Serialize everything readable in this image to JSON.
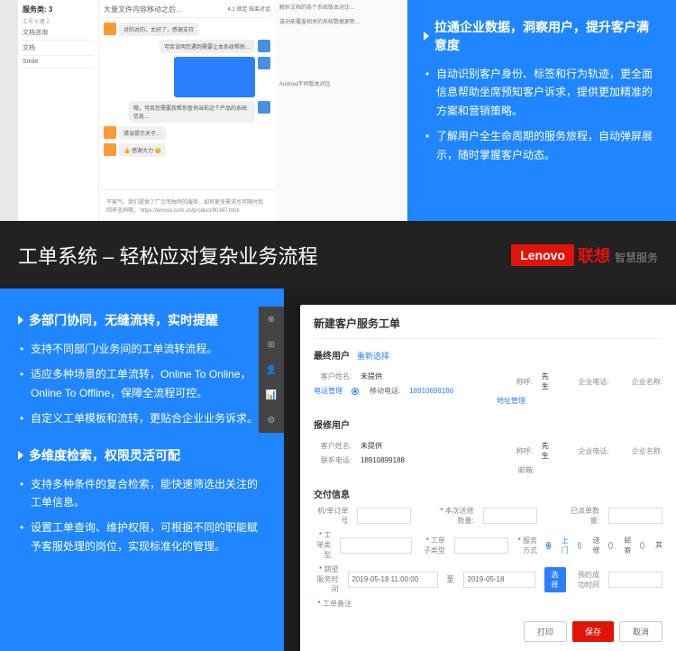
{
  "top": {
    "chat": {
      "list_title": "服务类: 3",
      "list_stat": "工号 0 理 2",
      "items": [
        "文档咨询",
        "文档",
        "Smile"
      ],
      "header": "大量文件内容移动之后…",
      "header_right": "4.1  锁定  结束对话",
      "msg1": "对的对的，太好了，感谢支持",
      "msg2": "可否说明您遇到需要让本系统帮助…",
      "msg3": "哦，可否您需要我帮你查询当前这个产品的系统信息…",
      "msg4": "错误提示关于…",
      "msg5": "👍 感谢大力 😊",
      "footer_text": "不客气，我们提供了广泛而独特的服务…如有更多需求也可随时我回来咨询哦，\nhttps://lenovo.com.cn/product/80387.html",
      "side1": "解析文档的各个系统版本对比…",
      "side2": "该功能覆盖相关的系统数据更新…",
      "side3": "Android不同版本对比"
    },
    "panel": {
      "title": "拉通企业数据，洞察用户，提升客户满意度",
      "b1": "自动识别客户身份、标签和行为轨迹，更全面信息帮助坐席预知客户诉求，提供更加精准的方案和营销策略。",
      "b2": "了解用户全生命周期的服务旅程，自动弹屏展示，随时掌握客户动态。"
    }
  },
  "mid": {
    "title": "工单系统 – 轻松应对复杂业务流程",
    "lenovo": "Lenovo",
    "cn1": "联想",
    "cn2": "智慧服务"
  },
  "left": {
    "t1": "多部门协同，无缝流转，实时提醒",
    "t1b1": "支持不同部门/业务间的工单流转流程。",
    "t1b2": "适应多种场景的工单流转，Online To Online，Online To Offline，保障全流程可控。",
    "t1b3": "自定义工单模板和流转，更贴合企业业务诉求。",
    "t2": "多维度检索，权限灵活可配",
    "t2b1": "支持多种条件的复合检索，能快速筛选出关注的工单信息。",
    "t2b2": "设置工单查询、维护权限，可根据不同的职能赋予客服处理的岗位，实现标准化的管理。"
  },
  "form": {
    "title": "新建客户服务工单",
    "sec_end_user": "最终用户",
    "reselect": "重新选择",
    "cust_name_lbl": "客户姓名:",
    "cust_name": "未提供",
    "honor_lbl": "称呼:",
    "honor": "先生",
    "corp_phone_lbl": "企业电话:",
    "corp_name_lbl": "企业名称:",
    "tel_label": "电话管理",
    "mobile_radio": "移动电话:",
    "mobile": "18910699186",
    "addr": "地址管理",
    "sec_repair": "报修用户",
    "contact_lbl": "联系电话:",
    "contact": "18910899188",
    "email_lbl": "邮箱:",
    "sec_deliver": "交付信息",
    "serial_lbl": "机/单订单号",
    "req": "本次送修数量:",
    "sent_lbl": "已派单数量:",
    "ticket_type": "工单类型",
    "sub_type": "工单子类型",
    "svc_mode": "服务方式",
    "svc_val": "上门",
    "opt_send": "送修",
    "opt_mail": "邮寄",
    "opt_other": "其",
    "expect": "期望服务时间",
    "date1": "2019-05-18 11:00:00",
    "to": "至",
    "date2": "2019-05-18",
    "select_btn": "选择",
    "appt_lbl": "预约成功时间",
    "note": "工单备注",
    "save": "保存",
    "cancel": "取消",
    "print": "打印"
  }
}
